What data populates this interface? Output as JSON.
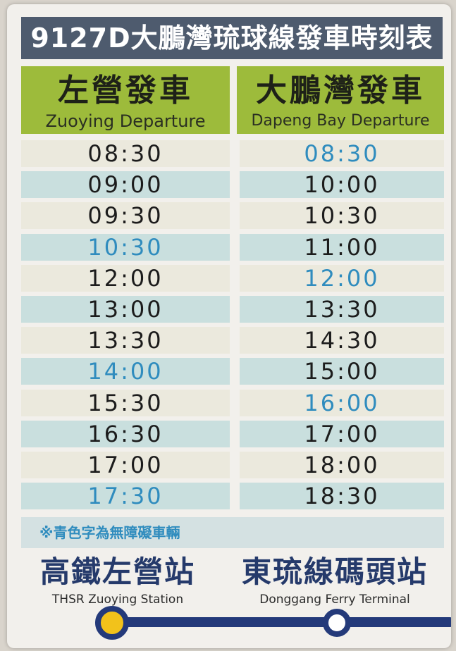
{
  "title": "9127D大鵬灣琉球線發車時刻表",
  "columns": {
    "left": {
      "zh": "左營發車",
      "en": "Zuoying Departure"
    },
    "right": {
      "zh": "大鵬灣發車",
      "en": "Dapeng Bay Departure"
    }
  },
  "schedule": [
    {
      "left": "08:30",
      "left_accessible": false,
      "right": "08:30",
      "right_accessible": true
    },
    {
      "left": "09:00",
      "left_accessible": false,
      "right": "10:00",
      "right_accessible": false
    },
    {
      "left": "09:30",
      "left_accessible": false,
      "right": "10:30",
      "right_accessible": false
    },
    {
      "left": "10:30",
      "left_accessible": true,
      "right": "11:00",
      "right_accessible": false
    },
    {
      "left": "12:00",
      "left_accessible": false,
      "right": "12:00",
      "right_accessible": true
    },
    {
      "left": "13:00",
      "left_accessible": false,
      "right": "13:30",
      "right_accessible": false
    },
    {
      "left": "13:30",
      "left_accessible": false,
      "right": "14:30",
      "right_accessible": false
    },
    {
      "left": "14:00",
      "left_accessible": true,
      "right": "15:00",
      "right_accessible": false
    },
    {
      "left": "15:30",
      "left_accessible": false,
      "right": "16:00",
      "right_accessible": true
    },
    {
      "left": "16:30",
      "left_accessible": false,
      "right": "17:00",
      "right_accessible": false
    },
    {
      "left": "17:00",
      "left_accessible": false,
      "right": "18:00",
      "right_accessible": false
    },
    {
      "left": "17:30",
      "left_accessible": true,
      "right": "18:30",
      "right_accessible": false
    }
  ],
  "note": "※青色字為無障礙車輛",
  "stations": {
    "start": {
      "zh": "高鐵左營站",
      "en": "THSR Zuoying Station"
    },
    "end": {
      "zh": "東琉線碼頭站",
      "en": "Donggang Ferry Terminal"
    }
  },
  "colors": {
    "title_bg": "#4e5b6e",
    "header_bg": "#9dbb3b",
    "accessible_text": "#2f8cbe",
    "row_shade": "#c9dfde",
    "route_line": "#243a7a",
    "start_dot": "#f2c21b"
  }
}
